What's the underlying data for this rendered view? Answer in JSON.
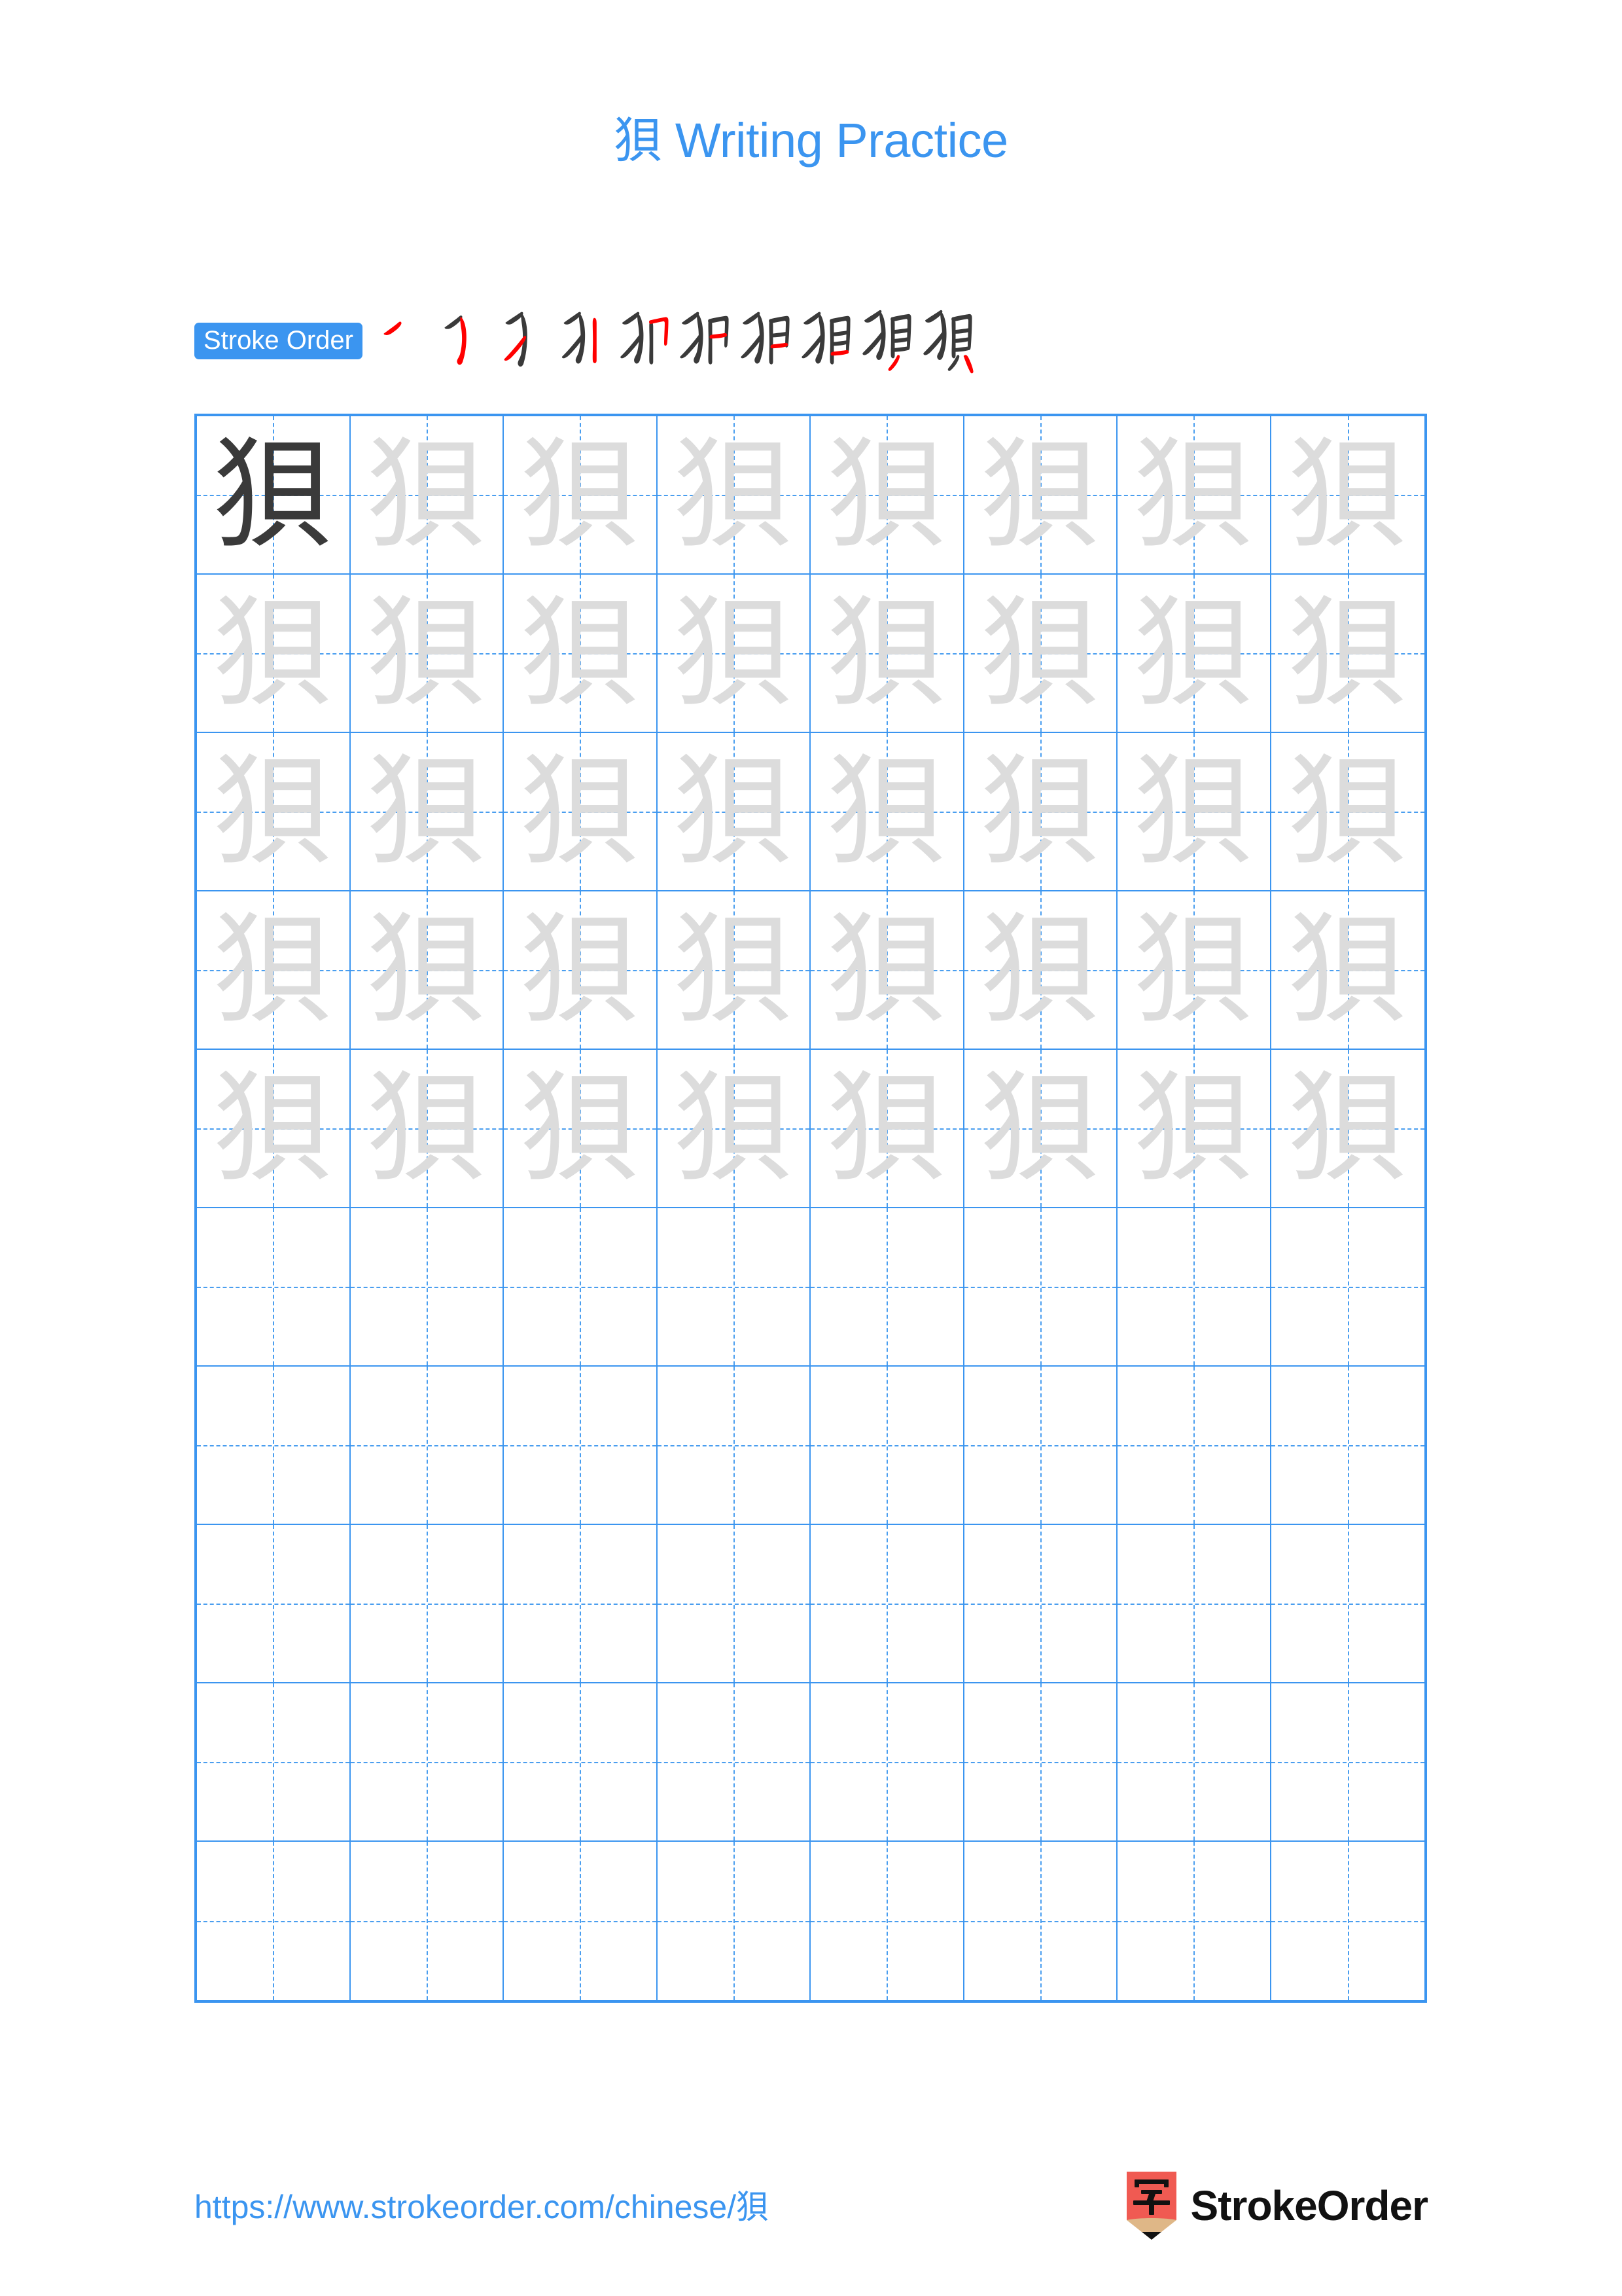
{
  "page": {
    "character": "狽",
    "background_color": "#ffffff",
    "accent_color": "#3b95f0",
    "trace_color": "#dcdcdc",
    "solid_ink_color": "#3a3a3a",
    "highlight_stroke_color": "#ff0000"
  },
  "header": {
    "title_character": "狽",
    "title_text": " Writing Practice",
    "title_full": "狽 Writing Practice"
  },
  "stroke_order": {
    "badge_label": "Stroke Order",
    "total_strokes": 10,
    "steps": [
      {
        "index": 1,
        "strokes_shown": 1,
        "new_stroke": "撇 (slanted left-falling)"
      },
      {
        "index": 2,
        "strokes_shown": 2,
        "new_stroke": "弯钩 (curved hook)"
      },
      {
        "index": 3,
        "strokes_shown": 3,
        "new_stroke": "撇 (slanted left-falling)"
      },
      {
        "index": 4,
        "strokes_shown": 4,
        "new_stroke": "竖 (vertical)"
      },
      {
        "index": 5,
        "strokes_shown": 5,
        "new_stroke": "横折 (horizontal turn)"
      },
      {
        "index": 6,
        "strokes_shown": 6,
        "new_stroke": "横 (horizontal)"
      },
      {
        "index": 7,
        "strokes_shown": 7,
        "new_stroke": "横 (horizontal)"
      },
      {
        "index": 8,
        "strokes_shown": 8,
        "new_stroke": "横 (horizontal)"
      },
      {
        "index": 9,
        "strokes_shown": 9,
        "new_stroke": "撇 (slanted left-falling)"
      },
      {
        "index": 10,
        "strokes_shown": 10,
        "new_stroke": "点 (dot)"
      }
    ]
  },
  "practice_grid": {
    "columns": 8,
    "rows": 10,
    "filled_rows": 5,
    "empty_rows": 5,
    "first_cell_style": "solid",
    "trace_character": "狽",
    "cell_guide": "dashed-cross"
  },
  "footer": {
    "url_prefix": "https://www.strokeorder.com/chinese/",
    "url_character": "狽",
    "url_full": "https://www.strokeorder.com/chinese/狽",
    "brand_name": "StrokeOrder",
    "brand_logo_character": "字",
    "brand_logo_color": "#f05a52",
    "brand_logo_tip_color": "#dfb787"
  }
}
